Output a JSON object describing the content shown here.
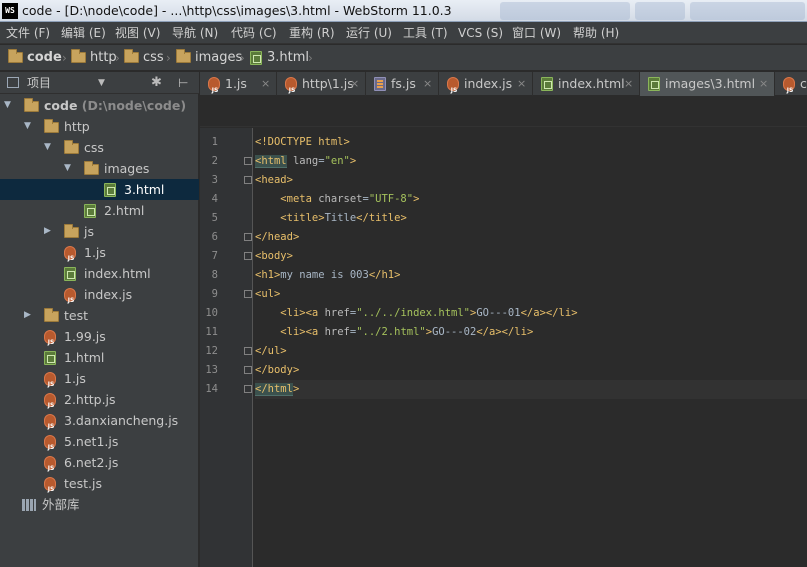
{
  "window": {
    "title": "code - [D:\\node\\code] - ...\\http\\css\\images\\3.html - WebStorm 11.0.3",
    "logo": "WS"
  },
  "menu": [
    "文件 (F)",
    "编辑 (E)",
    "视图 (V)",
    "导航 (N)",
    "代码 (C)",
    "重构 (R)",
    "运行 (U)",
    "工具 (T)",
    "VCS (S)",
    "窗口 (W)",
    "帮助 (H)"
  ],
  "breadcrumb": [
    "code",
    "http",
    "css",
    "images",
    "3.html"
  ],
  "project_panel": {
    "label": "项目",
    "dropdown": "▼",
    "gear": "✱",
    "pin": "⊢",
    "tree": [
      {
        "name": "code",
        "hint": "(D:\\node\\code)",
        "type": "folder",
        "depth": 0,
        "expanded": true,
        "bold": true
      },
      {
        "name": "http",
        "type": "folder",
        "depth": 1,
        "expanded": true
      },
      {
        "name": "css",
        "type": "folder",
        "depth": 2,
        "expanded": true
      },
      {
        "name": "images",
        "type": "folder",
        "depth": 3,
        "expanded": true
      },
      {
        "name": "3.html",
        "type": "html",
        "depth": 4,
        "selected": true
      },
      {
        "name": "2.html",
        "type": "html",
        "depth": 3
      },
      {
        "name": "js",
        "type": "folder",
        "depth": 2
      },
      {
        "name": "1.js",
        "type": "js",
        "depth": 2
      },
      {
        "name": "index.html",
        "type": "html",
        "depth": 2
      },
      {
        "name": "index.js",
        "type": "js",
        "depth": 2
      },
      {
        "name": "test",
        "type": "folder",
        "depth": 1,
        "collapsed": true
      },
      {
        "name": "1.99.js",
        "type": "js",
        "depth": 1
      },
      {
        "name": "1.html",
        "type": "html",
        "depth": 1
      },
      {
        "name": "1.js",
        "type": "js",
        "depth": 1
      },
      {
        "name": "2.http.js",
        "type": "js",
        "depth": 1
      },
      {
        "name": "3.danxiancheng.js",
        "type": "js",
        "depth": 1
      },
      {
        "name": "5.net1.js",
        "type": "js",
        "depth": 1
      },
      {
        "name": "6.net2.js",
        "type": "js",
        "depth": 1
      },
      {
        "name": "test.js",
        "type": "js",
        "depth": 1
      },
      {
        "name": "外部库",
        "type": "library",
        "depth": 0
      }
    ]
  },
  "tabs": [
    {
      "label": "1.js",
      "type": "js"
    },
    {
      "label": "http\\1.js",
      "type": "js"
    },
    {
      "label": "fs.js",
      "type": "fs"
    },
    {
      "label": "index.js",
      "type": "js"
    },
    {
      "label": "index.html",
      "type": "html"
    },
    {
      "label": "images\\3.html",
      "type": "html",
      "active": true
    },
    {
      "label": "c",
      "type": "js"
    }
  ],
  "tab_close": "×",
  "editor": {
    "current_line": 14,
    "lines": [
      {
        "n": "1",
        "text": "<!DOCTYPE html>"
      },
      {
        "n": "2",
        "text": "<html lang=\"en\">"
      },
      {
        "n": "3",
        "text": "<head>"
      },
      {
        "n": "4",
        "text": "    <meta charset=\"UTF-8\">"
      },
      {
        "n": "5",
        "text": "    <title>Title</title>"
      },
      {
        "n": "6",
        "text": "</head>"
      },
      {
        "n": "7",
        "text": "<body>"
      },
      {
        "n": "8",
        "text": "<h1>my name is 003</h1>"
      },
      {
        "n": "9",
        "text": "<ul>"
      },
      {
        "n": "10",
        "text": "    <li><a href=\"../../index.html\">GO---01</a></li>"
      },
      {
        "n": "11",
        "text": "    <li><a href=\"../2.html\">GO---02</a></li>"
      },
      {
        "n": "12",
        "text": "</ul>"
      },
      {
        "n": "13",
        "text": "</body>"
      },
      {
        "n": "14",
        "text": "</html>"
      }
    ]
  },
  "colors": {
    "background": "#2b2b2b",
    "panel": "#3c3f41",
    "selection": "#0d293e",
    "tag": "#e8bf6a",
    "attribute_value": "#a5c25c",
    "text": "#a9b7c6"
  }
}
